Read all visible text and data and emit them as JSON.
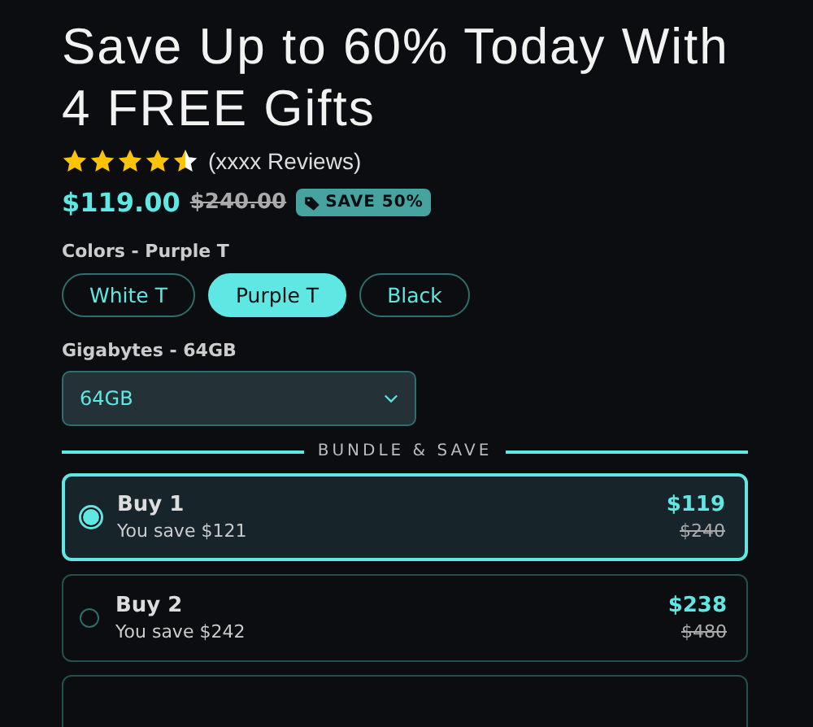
{
  "title": "Save Up to 60% Today With 4 FREE Gifts",
  "rating": {
    "stars": 4.5,
    "reviews": "(xxxx Reviews)"
  },
  "price": {
    "current": "$119.00",
    "original": "$240.00",
    "badge": "SAVE 50%"
  },
  "colors": {
    "label": "Colors - Purple T",
    "options": [
      {
        "label": "White T",
        "selected": false
      },
      {
        "label": "Purple T",
        "selected": true
      },
      {
        "label": "Black",
        "selected": false
      }
    ]
  },
  "gigabytes": {
    "label": "Gigabytes - 64GB",
    "value": "64GB"
  },
  "bundle_heading": "BUNDLE & SAVE",
  "bundles": [
    {
      "title": "Buy 1",
      "savings": "You save $121",
      "price": "$119",
      "original": "$240",
      "selected": true
    },
    {
      "title": "Buy 2",
      "savings": "You save $242",
      "price": "$238",
      "original": "$480",
      "selected": false
    },
    {
      "selected": false
    }
  ]
}
